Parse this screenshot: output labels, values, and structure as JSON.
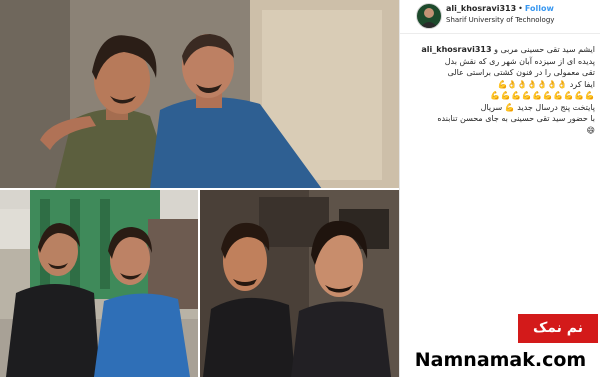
{
  "post": {
    "username": "ali_khosravi313",
    "separator": "•",
    "follow_label": "Follow",
    "location": "Sharif University of Technology",
    "avatar_icon": "user-avatar-icon"
  },
  "caption": {
    "username": "ali_khosravi313",
    "line1": "ایشم سید تقی حسینی مربی و",
    "line2": "پدیده ای از سیزده آبان شهر ری که نقش بدل",
    "line3": "تقی معمولی را در فنون کشتی براستی عالی",
    "line4": "ایفا کرد 👌👌👌👌👌👌💪",
    "line5": "💪💪💪💪💪💪💪💪💪💪",
    "line6": "پایتخت پنج درسال جدید 💪 سریال",
    "line7": "با حضور سید تقی حسینی به جای محسن تنابنده",
    "line8": "😄"
  },
  "branding": {
    "badge": "نم نمک",
    "site": "Namnamak.com",
    "badge_color": "#d31a1a"
  },
  "colors": {
    "follow": "#3897f0",
    "text": "#262626"
  }
}
